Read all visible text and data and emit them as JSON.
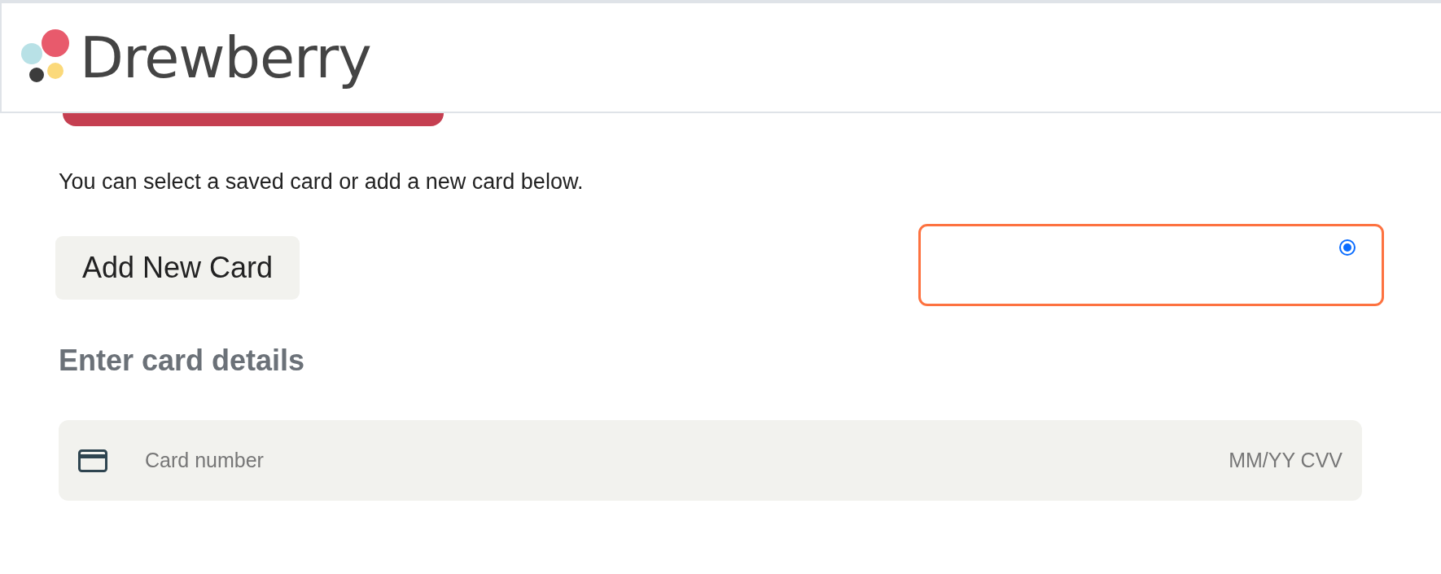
{
  "header": {
    "logo_text": "Drewberry"
  },
  "intro": "You can select a saved card or add a new card below.",
  "add_card_button": "Add New Card",
  "saved_cards": [
    {
      "selected": true
    }
  ],
  "card_details": {
    "heading": "Enter card details",
    "number_placeholder": "Card number",
    "expiry_cvv_placeholder": "MM/YY CVV"
  }
}
